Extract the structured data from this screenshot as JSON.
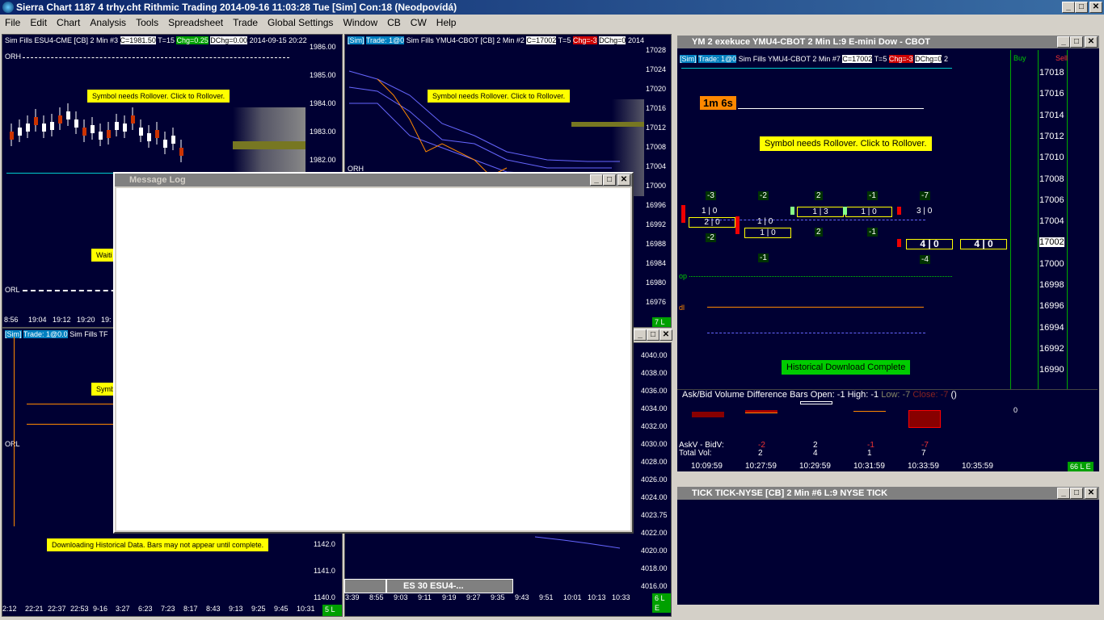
{
  "app": {
    "title": "Sierra Chart 1187 4 trhy.cht  Rithmic Trading 2014-09-16  11:03:28 Tue [Sim]  Con:18 (Neodpovídá)"
  },
  "menu": [
    "File",
    "Edit",
    "Chart",
    "Analysis",
    "Tools",
    "Spreadsheet",
    "Trade",
    "Global Settings",
    "Window",
    "CB",
    "CW",
    "Help"
  ],
  "c1": {
    "header": "Sim Fills  ESU4-CME [CB]  2 Min  #3",
    "c": "C=1981.50",
    "t": "T=15",
    "chg": "Chg=0.25",
    "dchg": "DChg=0.00",
    "date": "2014-09-15 20:22",
    "prices": [
      "1986.00",
      "1985.00",
      "1984.00",
      "1983.00",
      "1982.00"
    ],
    "rollover": "Symbol needs Rollover. Click to Rollover.",
    "orh": "ORH",
    "orl": "ORL",
    "waiting": "Waiti",
    "times": [
      "8:56",
      "19:04",
      "19:12",
      "19:20",
      "19:"
    ]
  },
  "c2": {
    "sim": "[Sim]",
    "trade": "Trade: 1@0",
    "header": "Sim Fills  YMU4-CBOT [CB]  2 Min  #2",
    "c": "C=17002",
    "t": "T=5",
    "chg": "Chg=-3",
    "dchg": "DChg=0",
    "date": "2014",
    "prices": [
      "17028",
      "17024",
      "17020",
      "17016",
      "17012",
      "17008",
      "17004",
      "17000",
      "16996",
      "16992",
      "16988",
      "16984",
      "16980",
      "16976"
    ],
    "cur": "17002",
    "rollover": "Symbol needs Rollover. Click to Rollover.",
    "orh": "ORH",
    "le": "7 L E"
  },
  "c3": {
    "sim": "[Sim]",
    "trade": "Trade: 1@0.0",
    "header": "Sim Fills  TF",
    "symb": "Symb",
    "orl": "ORL",
    "download": "Downloading Historical Data. Bars may not appear until complete.",
    "prices": [
      "1142.0",
      "1141.0",
      "1140.0"
    ],
    "times": [
      "2:12",
      "22:21",
      "22:37",
      "22:53",
      "9-16",
      "3:27",
      "6:23",
      "7:23",
      "8:17",
      "8:43",
      "9:13",
      "9:25",
      "9:45",
      "10:31"
    ],
    "le": "5 L E"
  },
  "c4": {
    "prices": [
      "4040.00",
      "4038.00",
      "4036.00",
      "4034.00",
      "4032.00",
      "4030.00",
      "4028.00",
      "4026.00",
      "4024.00",
      "4023.75",
      "4022.00",
      "4020.00",
      "4018.00",
      "4016.00"
    ],
    "cur": "4023.75",
    "times": [
      "3:39",
      "8:55",
      "9:03",
      "9:11",
      "9:19",
      "9:27",
      "9:35",
      "9:43",
      "9:51",
      "10:01",
      "10:13",
      "10:33"
    ],
    "le": "6 L E"
  },
  "es30": {
    "title": "ES 30  ESU4-..."
  },
  "msglog": {
    "title": "Message Log"
  },
  "ym": {
    "title": "YM 2 exekuce  YMU4-CBOT  2 Min  L:9  E-mini Dow - CBOT",
    "sim": "[Sim]",
    "trade": "Trade: 1@0",
    "header": "Sim Fills  YMU4-CBOT  2 Min   #7",
    "c": "C=17002",
    "t": "T=5",
    "chg": "Chg=-3",
    "dchg": "DChg=0",
    "extra": "2",
    "buy": "Buy",
    "sell": "Sell",
    "timer": "1m 6s",
    "rollover": "Symbol needs Rollover. Click to Rollover.",
    "hist": "Historical Download Complete",
    "op": "op",
    "dl": "dl",
    "prices": [
      "17018",
      "17016",
      "17014",
      "17012",
      "17010",
      "17008",
      "17006",
      "17004",
      "17002",
      "17000",
      "16998",
      "16996",
      "16994",
      "16992",
      "16990"
    ],
    "cur": "17002",
    "delta_top": [
      "-3",
      "-2",
      "2",
      "-1",
      "-7"
    ],
    "delta_bot": [
      "-2",
      "-1",
      "2",
      "-1",
      "-4"
    ],
    "fp": [
      "1 | 0",
      "2 | 0",
      "1 | 0",
      "1 | 0",
      "1 | 3",
      "1 | 0",
      "3 | 0",
      "4 | 0",
      "4 | 0"
    ],
    "study": "Ask/Bid Volume Difference Bars  Open: -1  High: -1",
    "low": "Low: -7",
    "close": "Close: -7",
    "paren": "()",
    "zero": "0",
    "askv": "AskV - BidV:",
    "totv": "Total Vol:",
    "askvals": [
      "-2",
      "2",
      "-1",
      "-7"
    ],
    "totals": [
      "2",
      "4",
      "1",
      "7"
    ],
    "times": [
      "10:09:59",
      "10:27:59",
      "10:29:59",
      "10:31:59",
      "10:33:59",
      "10:35:59"
    ],
    "le": "66 L E"
  },
  "tick": {
    "title": "TICK  TICK-NYSE [CB]  2 Min   #6  L:9  NYSE TICK"
  },
  "colors": {
    "bg": "#000033",
    "yellow": "#ffff00",
    "green": "#00a000",
    "red": "#cc0000",
    "orange": "#ff8800"
  }
}
